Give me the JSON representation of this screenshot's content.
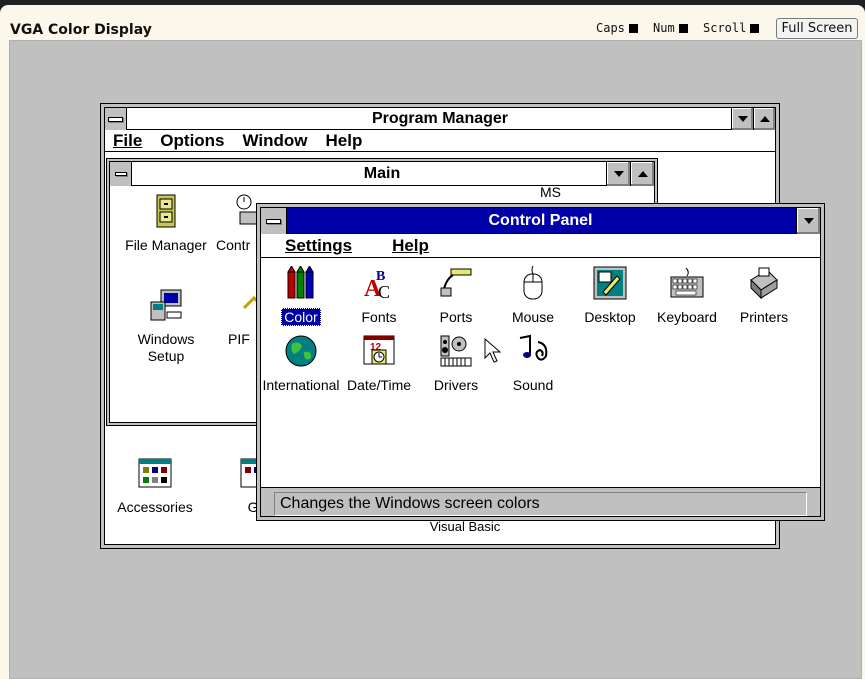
{
  "app": {
    "title": "VGA Color Display",
    "indicators": [
      "Caps",
      "Num",
      "Scroll"
    ],
    "fullscreen_label": "Full Screen"
  },
  "program_manager": {
    "title": "Program Manager",
    "menu": [
      "File",
      "Options",
      "Window",
      "Help"
    ],
    "groups": [
      {
        "label": "Accessories",
        "icon": "accessories-group-icon"
      },
      {
        "label": "Ga",
        "icon": "games-group-icon"
      },
      {
        "label": "Visual Basic",
        "icon": "visual-basic-group-icon"
      }
    ]
  },
  "main_group": {
    "title": "Main",
    "icons": [
      {
        "label": "File Manager",
        "icon": "file-cabinet-icon"
      },
      {
        "label": "Contr",
        "icon": "control-panel-icon"
      },
      {
        "label": "Windows Setup",
        "icon": "windows-setup-icon"
      },
      {
        "label": "PIF",
        "icon": "pif-editor-icon"
      }
    ],
    "partial_top_label": "MS"
  },
  "control_panel": {
    "title": "Control Panel",
    "menu": [
      "Settings",
      "Help"
    ],
    "icons": [
      {
        "label": "Color",
        "icon": "color-crayons-icon",
        "selected": true
      },
      {
        "label": "Fonts",
        "icon": "fonts-icon"
      },
      {
        "label": "Ports",
        "icon": "ports-icon"
      },
      {
        "label": "Mouse",
        "icon": "mouse-icon"
      },
      {
        "label": "Desktop",
        "icon": "desktop-icon"
      },
      {
        "label": "Keyboard",
        "icon": "keyboard-icon"
      },
      {
        "label": "Printers",
        "icon": "printer-icon"
      },
      {
        "label": "International",
        "icon": "globe-icon"
      },
      {
        "label": "Date/Time",
        "icon": "calendar-clock-icon"
      },
      {
        "label": "Drivers",
        "icon": "drivers-icon"
      },
      {
        "label": "Sound",
        "icon": "sound-icon"
      }
    ],
    "status": "Changes the Windows screen colors"
  },
  "colors": {
    "active_title": "#0000a8",
    "desktop": "#c0c0c0",
    "selection": "#0000a8"
  }
}
